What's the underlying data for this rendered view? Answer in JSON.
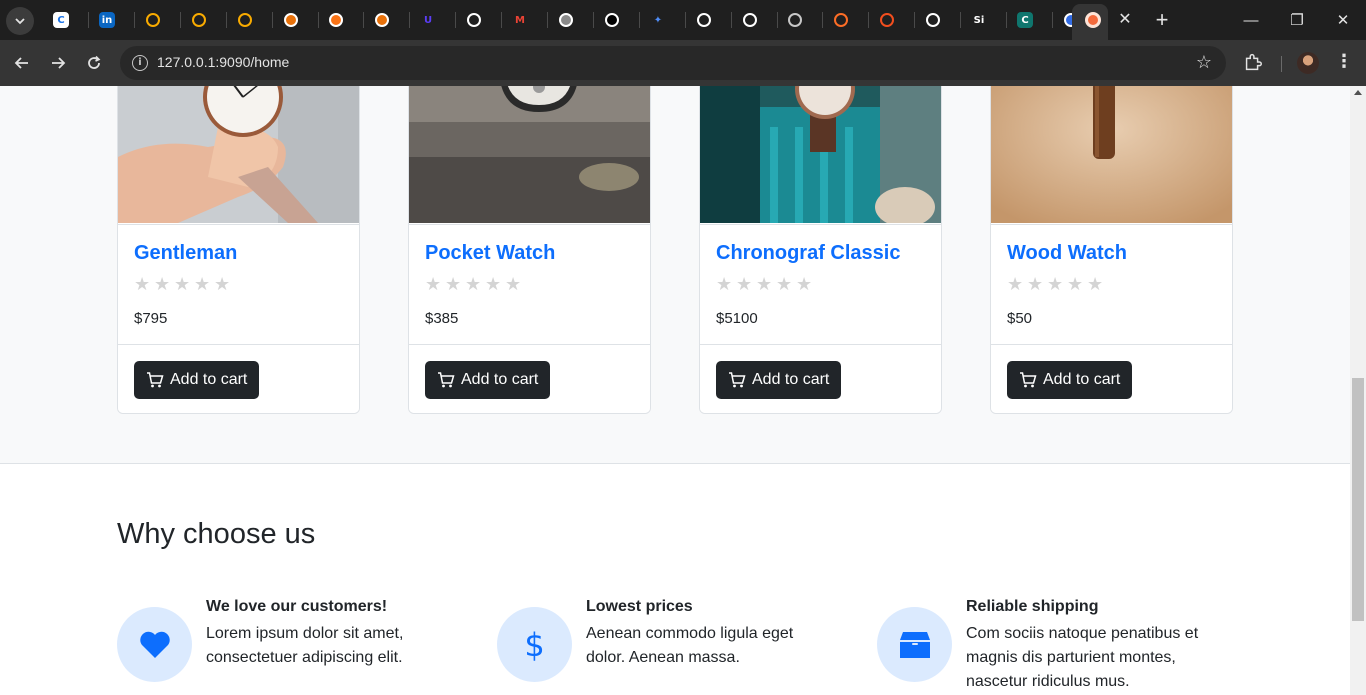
{
  "browser": {
    "url": "127.0.0.1:9090/home",
    "tab_close_glyph": "✕",
    "new_tab_glyph": "+",
    "window_controls": {
      "minimize": "—",
      "maximize": "❐",
      "close": "✕"
    },
    "favicons": [
      {
        "name": "c-icon",
        "letter": "C",
        "color": "#1a73e8",
        "bg": "#ffffff"
      },
      {
        "name": "linkedin-icon",
        "letter": "in",
        "color": "#ffffff",
        "bg": "#0a66c2"
      },
      {
        "name": "google-cloud-icon",
        "letter": "",
        "color": "#f9ab00",
        "bg": "transparent"
      },
      {
        "name": "google-cloud-icon",
        "letter": "",
        "color": "#f9ab00",
        "bg": "transparent"
      },
      {
        "name": "google-cloud-icon",
        "letter": "",
        "color": "#f9ab00",
        "bg": "transparent"
      },
      {
        "name": "orange-app-icon",
        "letter": "",
        "color": "#ffffff",
        "bg": "#e8710a"
      },
      {
        "name": "orange-cube-icon",
        "letter": "",
        "color": "#ffffff",
        "bg": "#f97316"
      },
      {
        "name": "orange-app-icon",
        "letter": "",
        "color": "#ffffff",
        "bg": "#e8710a"
      },
      {
        "name": "u-icon",
        "letter": "U",
        "color": "#5b3df5",
        "bg": "transparent"
      },
      {
        "name": "github-icon",
        "letter": "",
        "color": "#ffffff",
        "bg": "transparent"
      },
      {
        "name": "gmail-icon",
        "letter": "M",
        "color": "#ea4335",
        "bg": "transparent"
      },
      {
        "name": "youtube-icon",
        "letter": "",
        "color": "#ffffff",
        "bg": "#8a8a8a"
      },
      {
        "name": "chat-bot-icon",
        "letter": "",
        "color": "#ffffff",
        "bg": "#000000"
      },
      {
        "name": "gemini-icon",
        "letter": "✦",
        "color": "#4f8df7",
        "bg": "transparent"
      },
      {
        "name": "github-icon",
        "letter": "",
        "color": "#ffffff",
        "bg": "transparent"
      },
      {
        "name": "github-icon",
        "letter": "",
        "color": "#ffffff",
        "bg": "transparent"
      },
      {
        "name": "globe-icon",
        "letter": "",
        "color": "#c7c7c7",
        "bg": "transparent"
      },
      {
        "name": "gitlab-icon",
        "letter": "",
        "color": "#fc6d26",
        "bg": "transparent"
      },
      {
        "name": "figma-icon",
        "letter": "",
        "color": "#f24e1e",
        "bg": "transparent"
      },
      {
        "name": "github-icon",
        "letter": "",
        "color": "#ffffff",
        "bg": "transparent"
      },
      {
        "name": "si-icon",
        "letter": "Si",
        "color": "#ffffff",
        "bg": "transparent"
      },
      {
        "name": "c-green-icon",
        "letter": "C",
        "color": "#ffffff",
        "bg": "#0f766e"
      },
      {
        "name": "kubernetes-icon",
        "letter": "",
        "color": "#ffffff",
        "bg": "#326ce5"
      }
    ]
  },
  "products": [
    {
      "title": "Gentleman",
      "price": "$795",
      "cart_label": "Add to cart",
      "rating": 0,
      "stars": [
        "★",
        "★",
        "★",
        "★",
        "★"
      ]
    },
    {
      "title": "Pocket Watch",
      "price": "$385",
      "cart_label": "Add to cart",
      "rating": 0,
      "stars": [
        "★",
        "★",
        "★",
        "★",
        "★"
      ]
    },
    {
      "title": "Chronograf Classic",
      "price": "$5100",
      "cart_label": "Add to cart",
      "rating": 0,
      "stars": [
        "★",
        "★",
        "★",
        "★",
        "★"
      ]
    },
    {
      "title": "Wood Watch",
      "price": "$50",
      "cart_label": "Add to cart",
      "rating": 0,
      "stars": [
        "★",
        "★",
        "★",
        "★",
        "★"
      ]
    }
  ],
  "why": {
    "title": "Why choose us",
    "features": [
      {
        "icon": "heart-icon",
        "heading": "We love our customers!",
        "text": "Lorem ipsum dolor sit amet, consectetuer adipiscing elit."
      },
      {
        "icon": "dollar-icon",
        "heading": "Lowest prices",
        "text": "Aenean commodo ligula eget dolor. Aenean massa."
      },
      {
        "icon": "box-icon",
        "heading": "Reliable shipping",
        "text": "Com sociis natoque penatibus et magnis dis parturient montes, nascetur ridiculus mus."
      }
    ]
  },
  "colors": {
    "accent": "#0d6efd",
    "button_dark": "#212529",
    "icon_circle": "#dbeafe"
  }
}
